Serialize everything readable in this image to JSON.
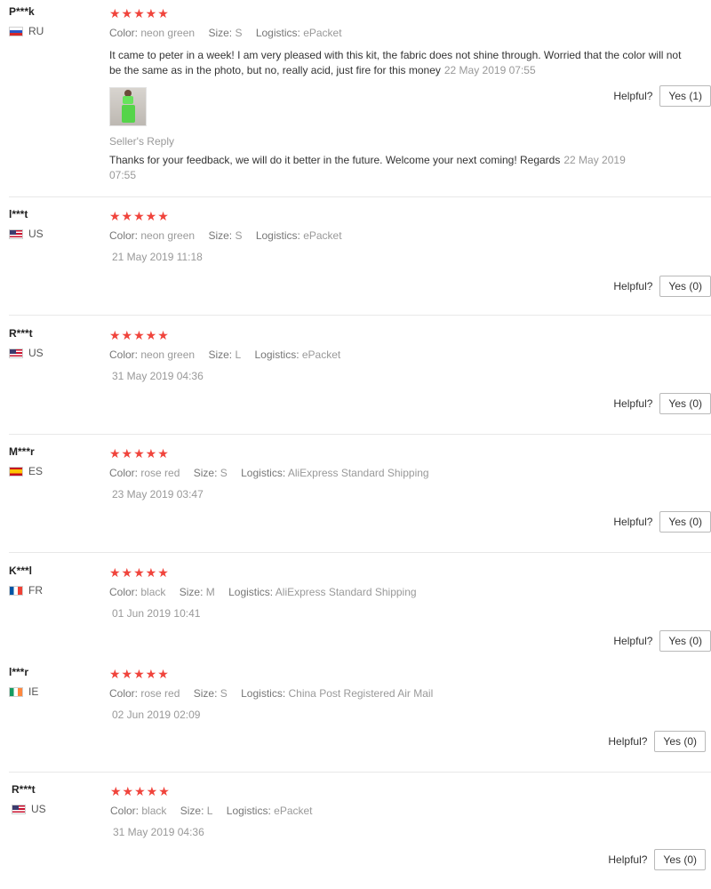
{
  "labels": {
    "color": "Color:",
    "size": "Size:",
    "logistics": "Logistics:",
    "helpful": "Helpful?",
    "stars": "★★★★★"
  },
  "reviews": [
    {
      "user": "P***k",
      "country": "RU",
      "color": "neon green",
      "size": "S",
      "logistics": "ePacket",
      "text": "It came to peter in a week! I am very pleased with this kit, the fabric does not shine through. Worried that the color will not be the same as in the photo, but no, really acid, just fire for this money",
      "date": "22 May 2019 07:55",
      "seller_reply_title": "Seller's Reply",
      "seller_reply": "Thanks for your feedback, we will do it better in the future. Welcome your next coming! Regards",
      "seller_reply_date": "22 May 2019 07:55",
      "helpful": "Yes (1)"
    },
    {
      "user": "l***t",
      "country": "US",
      "color": "neon green",
      "size": "S",
      "logistics": "ePacket",
      "date": "21 May 2019 11:18",
      "helpful": "Yes (0)"
    },
    {
      "user": "R***t",
      "country": "US",
      "color": "neon green",
      "size": "L",
      "logistics": "ePacket",
      "date": "31 May 2019 04:36",
      "helpful": "Yes (0)"
    },
    {
      "user": "M***r",
      "country": "ES",
      "color": "rose red",
      "size": "S",
      "logistics": "AliExpress Standard Shipping",
      "date": "23 May 2019 03:47",
      "helpful": "Yes (0)"
    },
    {
      "user": "K***l",
      "country": "FR",
      "color": "black",
      "size": "M",
      "logistics": "AliExpress Standard Shipping",
      "date": "01 Jun 2019 10:41",
      "helpful": "Yes (0)"
    },
    {
      "user": "l***r",
      "country": "IE",
      "color": "rose red",
      "size": "S",
      "logistics": "China Post Registered Air Mail",
      "date": "02 Jun 2019 02:09",
      "helpful": "Yes (0)"
    },
    {
      "user": "R***t",
      "country": "US",
      "color": "black",
      "size": "L",
      "logistics": "ePacket",
      "date": "31 May 2019 04:36",
      "helpful": "Yes (0)"
    }
  ]
}
